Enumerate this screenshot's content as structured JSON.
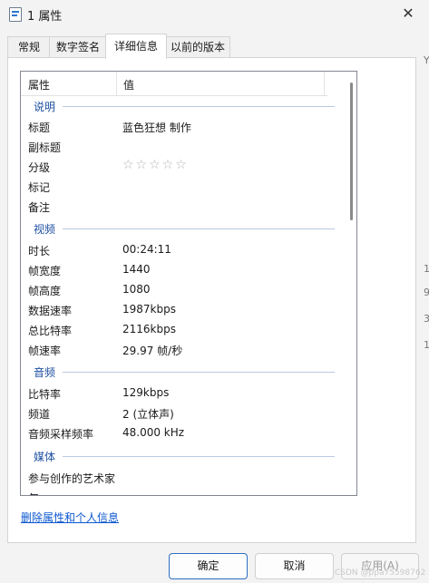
{
  "window": {
    "title": "1 属性",
    "close_icon": "close-icon"
  },
  "tabs": [
    "常规",
    "数字签名",
    "详细信息",
    "以前的版本"
  ],
  "list": {
    "header": {
      "property": "属性",
      "value": "值"
    },
    "groups": [
      {
        "name": "说明",
        "rows": [
          {
            "property": "标题",
            "value": "蓝色狂想 制作"
          },
          {
            "property": "副标题",
            "value": ""
          },
          {
            "property": "分级",
            "value": "☆☆☆☆☆"
          },
          {
            "property": "标记",
            "value": ""
          },
          {
            "property": "备注",
            "value": ""
          }
        ]
      },
      {
        "name": "视频",
        "rows": [
          {
            "property": "时长",
            "value": "00:24:11"
          },
          {
            "property": "帧宽度",
            "value": "1440"
          },
          {
            "property": "帧高度",
            "value": "1080"
          },
          {
            "property": "数据速率",
            "value": "1987kbps"
          },
          {
            "property": "总比特率",
            "value": "2116kbps"
          },
          {
            "property": "帧速率",
            "value": "29.97 帧/秒"
          }
        ]
      },
      {
        "name": "音频",
        "rows": [
          {
            "property": "比特率",
            "value": "129kbps"
          },
          {
            "property": "频道",
            "value": "2 (立体声)"
          },
          {
            "property": "音频采样频率",
            "value": "48.000 kHz"
          }
        ]
      },
      {
        "name": "媒体",
        "rows": [
          {
            "property": "参与创作的艺术家",
            "value": ""
          },
          {
            "property": "年",
            "value": ""
          }
        ]
      }
    ]
  },
  "remove_link": "删除属性和个人信息",
  "buttons": {
    "ok": "确定",
    "cancel": "取消",
    "apply": "应用(A)"
  },
  "watermark": "CSDN @ppa75598762",
  "side_fragments": [
    "Y",
    "1",
    "9",
    "3",
    "1"
  ]
}
